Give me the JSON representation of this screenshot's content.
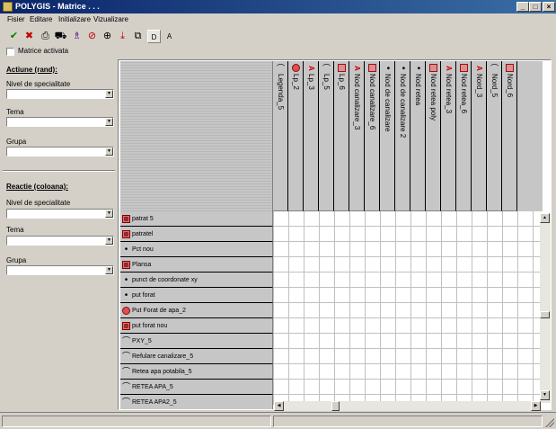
{
  "window": {
    "title": "POLYGIS - Matrice . . .",
    "controls": [
      "_",
      "□",
      "×"
    ]
  },
  "menu": [
    "Fisier",
    "Editare",
    "Initializare",
    "Vizualizare"
  ],
  "toolbar": {
    "buttons": [
      {
        "icon": "check-icon",
        "glyph": "✔",
        "color": "#008000"
      },
      {
        "icon": "cancel-icon",
        "glyph": "✖",
        "color": "#c00000"
      },
      {
        "icon": "print-icon",
        "glyph": "⎙",
        "color": "#000000"
      },
      {
        "icon": "truck-icon",
        "glyph": "⛟",
        "color": "#000000"
      },
      {
        "icon": "wizard-icon",
        "glyph": "♗",
        "color": "#400080"
      },
      {
        "icon": "stop-icon",
        "glyph": "⊘",
        "color": "#c00000"
      },
      {
        "icon": "target-icon",
        "glyph": "⊕",
        "color": "#000000"
      },
      {
        "icon": "download-icon",
        "glyph": "⤓",
        "color": "#c00000"
      },
      {
        "icon": "network-icon",
        "glyph": "⧉",
        "color": "#000000"
      }
    ],
    "d_label": "D",
    "a_label": "A"
  },
  "matrix_checkbox": {
    "label": "Matrice activata",
    "checked": false
  },
  "action_section": {
    "title": "Actiune (rand):",
    "fields": [
      {
        "label": "Nivel de specialitate",
        "value": ""
      },
      {
        "label": "Tema",
        "value": ""
      },
      {
        "label": "Grupa",
        "value": ""
      }
    ]
  },
  "reaction_section": {
    "title": "Reactie (coloana):",
    "fields": [
      {
        "label": "Nivel de specialitate",
        "value": ""
      },
      {
        "label": "Tema",
        "value": ""
      },
      {
        "label": "Grupa",
        "value": ""
      }
    ]
  },
  "columns": [
    {
      "label": "Legenda_5",
      "glyph": "curve"
    },
    {
      "label": "Lp_2",
      "glyph": "circle"
    },
    {
      "label": "Lp_3",
      "glyph": "a"
    },
    {
      "label": "Lp_5",
      "glyph": "curve"
    },
    {
      "label": "Lp_6",
      "glyph": "square"
    },
    {
      "label": "Nod canalizare_3",
      "glyph": "a"
    },
    {
      "label": "Nod canalizare_6",
      "glyph": "square"
    },
    {
      "label": "Nod de canalizare",
      "glyph": "dot"
    },
    {
      "label": "Nod de canalizare 2",
      "glyph": "dot"
    },
    {
      "label": "Nod retea",
      "glyph": "dot"
    },
    {
      "label": "Nod retea poly",
      "glyph": "square"
    },
    {
      "label": "Nod retea_3",
      "glyph": "a"
    },
    {
      "label": "Nod retea_6",
      "glyph": "square"
    },
    {
      "label": "Nord_3",
      "glyph": "a"
    },
    {
      "label": "Nord_5",
      "glyph": "curve"
    },
    {
      "label": "Nord_6",
      "glyph": "square"
    }
  ],
  "rows": [
    {
      "label": "patrat 5",
      "glyph": "square-x"
    },
    {
      "label": "patratel",
      "glyph": "square-x"
    },
    {
      "label": "Pct nou",
      "glyph": "dot"
    },
    {
      "label": "Plansa",
      "glyph": "square-x"
    },
    {
      "label": "punct de coordonate xy",
      "glyph": "dot"
    },
    {
      "label": "put forat",
      "glyph": "dot"
    },
    {
      "label": "Put Forat de apa_2",
      "glyph": "circle"
    },
    {
      "label": "put forat nou",
      "glyph": "square-x"
    },
    {
      "label": "PXY_5",
      "glyph": "curve"
    },
    {
      "label": "Refulare canalizare_5",
      "glyph": "curve"
    },
    {
      "label": "Retea apa potabila_5",
      "glyph": "curve"
    },
    {
      "label": "RETEA APA_5",
      "glyph": "curve"
    },
    {
      "label": "RETEA APA2_5",
      "glyph": "curve"
    }
  ],
  "scroll": {
    "up": "▲",
    "down": "▼",
    "left": "◀",
    "right": "▶"
  }
}
